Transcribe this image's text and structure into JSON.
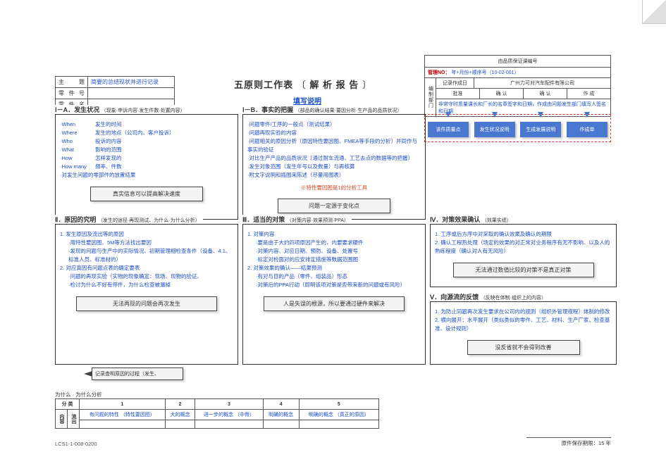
{
  "topleft": {
    "rows": [
      {
        "label": "主 题",
        "value": "简要的总结现状并进行记录"
      },
      {
        "label": "零 件 号",
        "value": ""
      },
      {
        "label": "零 件 名",
        "value": ""
      }
    ]
  },
  "title": {
    "main_left": "五原则工作表",
    "bracket_l": "〔",
    "main_right": "解 析 报 告",
    "bracket_r": "〕",
    "sub": "填写说明"
  },
  "topright": {
    "box1": "由品质保证课编号",
    "box2_label": "管理NO：",
    "box2_value": "年+月份+顺序号（10-02-001）",
    "side": "编制部门",
    "header_small": "记录作成日",
    "company": "广州力可对汽车配件有限公司",
    "cols": [
      "批准",
      "确 认",
      "确 认",
      "作 成"
    ],
    "note": "非常守时质量课长和厂长的名章签字和日期，作成由问题发生部门填写人签名和日期"
  },
  "flow": [
    "该件质量点",
    "发生状况说明",
    "生成发展说明",
    "作成单"
  ],
  "panelA": {
    "title": "Ⅰ－A．发生状况",
    "note": "（现象·申诉内容·发生件数·处置内容）",
    "rows": [
      {
        "w": "·When",
        "t": "发生的时间"
      },
      {
        "w": "·Where",
        "t": "发生的地点（公司内、客户投诉）"
      },
      {
        "w": "·Who",
        "t": "投诉的内容"
      },
      {
        "w": "·What",
        "t": "影响的范围"
      },
      {
        "w": "·How",
        "t": "怎样发现的"
      },
      {
        "w": "·How many",
        "t": "频率、件数"
      }
    ],
    "tail": "·对发生问题的零部件的放置结果",
    "callout": "真实信息可以提高解决速度"
  },
  "panelB": {
    "title": "Ⅰ－B．事实的把握",
    "note": "（部品的确认结果·要因分析·生产品的品质状况）",
    "items": [
      "·问题零件/工序的一般点（测试结果）",
      "·问题再现实验的内容",
      "·问题相关的原因分析〔原因特性要因图、FMEA等手段的分析〕并同作与事实的验证",
      "·对比生产产品的品质状况〔通过耐车流通、工艺去点的数据等的把握〕",
      "·发生对象范围（发生年号以及数量）与再核算",
      "·附文字说明和插图来陈述（尽量用图表）"
    ],
    "special": "※特性要因图是1的分析工具",
    "callout": "问题一定源于变化点"
  },
  "panel2": {
    "title": "Ⅱ．原因的究明",
    "note": "（发生的途径·再现测试、为什么·为什么分析）",
    "lines": [
      "1. 发生原因及流出等的原因",
      "  ·用特性要因图、5M等方法找出要因",
      "  ·发现的问题与生产中的实际情况、初期管理相检查条件（设备、4.1、标准人员、标准材的）",
      "2. 对应真因有问题点表的确定要表",
      "  ·问题的再现实验（实物的现象确定：现场、现物的验证、",
      "  ·检讨为什么不好有停件，为什么检查被漏掉"
    ],
    "callout": "无法再现的问题会再次发生",
    "why_note": "记录查明原因的过程（发生、",
    "why_label": "为什么 · 为什么分析"
  },
  "panel3": {
    "title": "Ⅲ．适当的对策",
    "note": "（对策内容·效果预测·PPA）",
    "lines": [
      "1. 对策内容",
      "  ·要是由于大约四项原因产生的，内要要求硬件",
      "  ·对策内容、对应日期、预防、设备、处置号",
      "  ·标定对检面对的应安排定措施等数据范围图",
      "2. 对策效果的确认——结果预测",
      "  ·有对与目的产品（零件、组装品）形态",
      "  ·对策后的PPA行动〔即明该项对策是否带来新的问题或有风险〕"
    ],
    "callout": "人是失误的根源，所以要通过硬件来解决"
  },
  "panel4": {
    "title": "Ⅳ．对策效果确认",
    "note": "（效果实绩）",
    "lines": [
      "1. 工序或后方序中对采取的确认效果及确认的期限",
      "2. 确认工程热处理（场定的效果的对正常对业务程序有无不影响、以及人的熟练程度（确认对人有无风险）"
    ],
    "callout": "无法通过数值比较的对策不是真正对策"
  },
  "panel5": {
    "title": "Ⅴ．向源流的反馈",
    "note": "（反映在体制·组织上的内容）",
    "lines": [
      "1. 为防止同题再次发生要求在公司内的规则（组织外管理规程）体制的修改",
      "2. 横向展开：水平展开（类似类似的零件、工艺、材料、生产厂家、检查基准、设计规则）"
    ],
    "callout": "没反省就不会得到改善"
  },
  "analysis_table": {
    "head": [
      "分 类",
      "1",
      "2",
      "3",
      "4",
      "5"
    ],
    "side": [
      "内容",
      "流出"
    ],
    "row_content": [
      "有问题的特性\n（特性要因图）",
      "大的概念",
      "进一步的概念\n（中骨）",
      "明确的概念",
      "明确的概念\n（真正的原因）"
    ]
  },
  "footer": {
    "left": "LCS1-1-008-0200",
    "right": "原件保存期限：15 年"
  }
}
